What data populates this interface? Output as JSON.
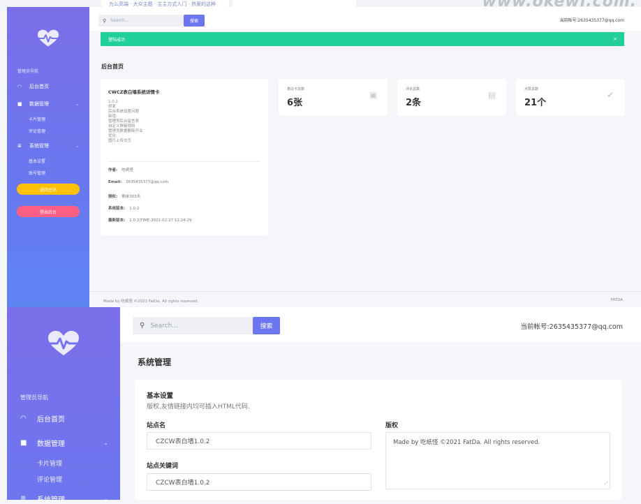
{
  "top_strip": {
    "links": "为么高端 · 大众主题 · 主主方式人门 · 热爱的这种",
    "watermark": "www.okewl.com."
  },
  "screen_a": {
    "sidebar": {
      "nav_title": "管理员导航",
      "items": [
        {
          "label": "后台首页",
          "icon": "dashboard-icon"
        },
        {
          "label": "数据管理",
          "icon": "data-icon",
          "sub": [
            "卡片管理",
            "评论管理"
          ]
        },
        {
          "label": "系统管理",
          "icon": "settings-icon",
          "sub": [
            "基本设置",
            "账号管理"
          ]
        }
      ],
      "return_button": "返回主站",
      "logout_button": "登出后台"
    },
    "header": {
      "search_placeholder": "Search...",
      "search_button": "搜索",
      "account": "当前帐号:2635435377@qq.com"
    },
    "alert": {
      "text": "登陆成功",
      "close": "×"
    },
    "page_title": "后台首页",
    "info_card": {
      "title": "CWCZ表白墙系统详情卡",
      "changelog": "1.0.2\n修复\n后台系统设置问题\n新增:\n管理员后台留言表\n自定义屏蔽规则\n管理员数据删除开关\n优化:\n图片上传交互",
      "rows": [
        {
          "label": "作者:",
          "value": "吃纸怪"
        },
        {
          "label": "Email:",
          "value": "2635435377@qq.com"
        },
        {
          "label": "授权:",
          "value": "剩余303天"
        },
        {
          "label": "系统版本:",
          "value": "1.0.2"
        },
        {
          "label": "最新版本:",
          "value": "1.0.2|TIME:2021-02-27 12:24:29"
        }
      ]
    },
    "stats": [
      {
        "label": "表白卡总数",
        "value": "6张",
        "icon": "heart-icon"
      },
      {
        "label": "评论总数",
        "value": "2条",
        "icon": "comment-icon"
      },
      {
        "label": "点赞总数",
        "value": "21个",
        "icon": "thumbs-up-icon"
      }
    ],
    "footer": {
      "left": "Made by 吃纸怪 ©2021 FatDa. All rights reserved.",
      "right": "FATDA"
    }
  },
  "screen_b": {
    "sidebar": {
      "nav_title": "管理员导航",
      "items": [
        {
          "label": "后台首页",
          "icon": "dashboard-icon"
        },
        {
          "label": "数据管理",
          "icon": "data-icon",
          "sub": [
            "卡片管理",
            "评论管理"
          ]
        },
        {
          "label": "系统管理",
          "icon": "settings-icon"
        }
      ]
    },
    "header": {
      "search_placeholder": "Search...",
      "search_button": "搜索",
      "account": "当前帐号:2635435377@qq.com"
    },
    "page_title": "系统管理",
    "form": {
      "heading": "基本设置",
      "subheading": "版权,友情链接内均可插入HTML代码.",
      "site_name_label": "站点名",
      "site_name_value": "CZCW表白墙1.0.2",
      "keywords_label": "站点关键词",
      "keywords_value": "CZCW表白墙1.0.2",
      "copyright_label": "版权",
      "copyright_value": "Made by 吃纸怪 ©2021 FatDa. All rights reserved."
    }
  },
  "colors": {
    "sidebar_top": "#7b6fe9",
    "sidebar_bottom": "#5e84f2",
    "accent": "#6c76f0",
    "success": "#20cf9a",
    "return_button": "#ffc107",
    "logout_button": "#ff5f85"
  }
}
